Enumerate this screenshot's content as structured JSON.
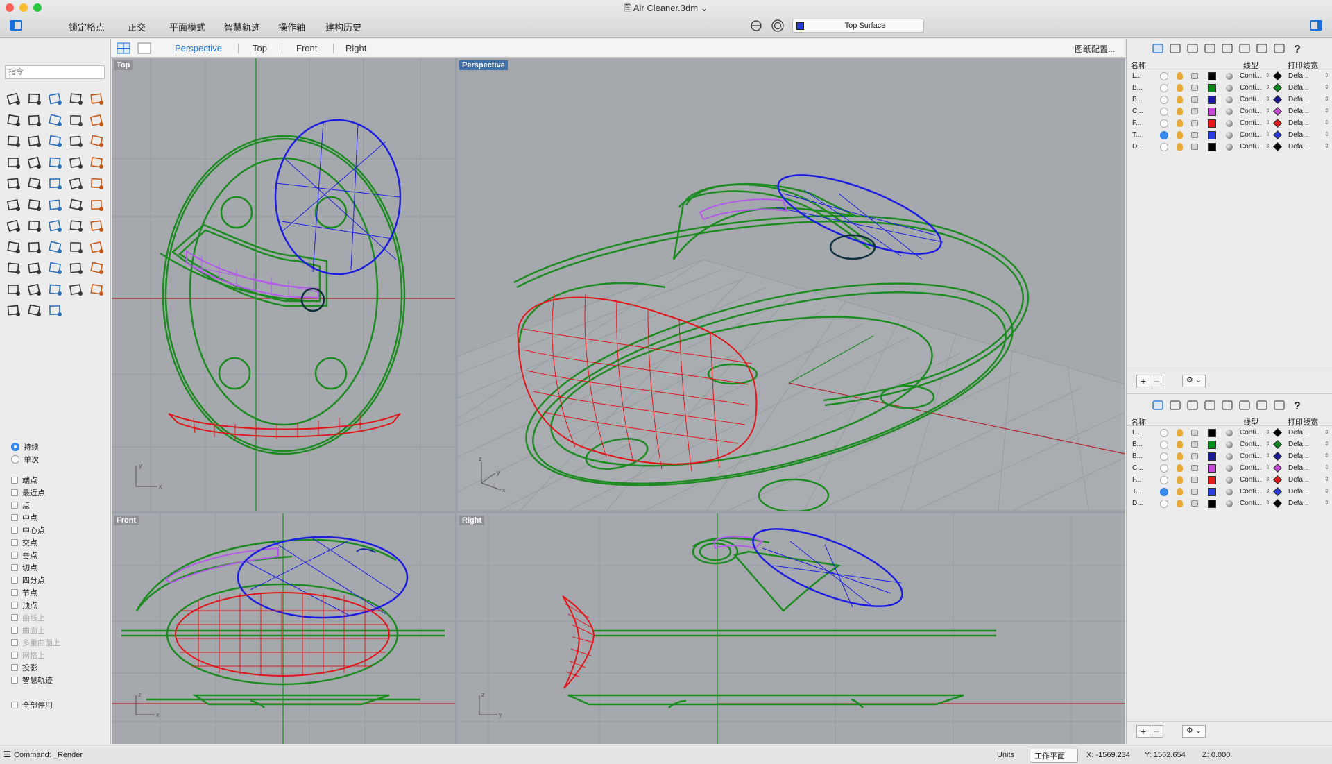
{
  "window": {
    "title": "Air Cleaner.3dm",
    "traffic_colors": [
      "#fc5f57",
      "#fdbc2e",
      "#28c840"
    ]
  },
  "toolbar": {
    "buttons": [
      "锁定格点",
      "正交",
      "平面模式",
      "智慧轨迹",
      "操作轴",
      "建构历史"
    ],
    "current_layer": "Top Surface",
    "current_layer_color": "#2a3de0"
  },
  "command": {
    "placeholder": "指令"
  },
  "view_tabs": {
    "tabs": [
      "Perspective",
      "Top",
      "Front",
      "Right"
    ],
    "active": "Perspective",
    "layout_button": "图纸配置..."
  },
  "viewports": {
    "top": "Top",
    "perspective": "Perspective",
    "front": "Front",
    "right": "Right"
  },
  "osnap": {
    "mode_options": [
      "持续",
      "单次"
    ],
    "mode_selected": "持续",
    "items": [
      {
        "label": "端点",
        "enabled": true
      },
      {
        "label": "最近点",
        "enabled": true
      },
      {
        "label": "点",
        "enabled": true
      },
      {
        "label": "中点",
        "enabled": true
      },
      {
        "label": "中心点",
        "enabled": true
      },
      {
        "label": "交点",
        "enabled": true
      },
      {
        "label": "垂点",
        "enabled": true
      },
      {
        "label": "切点",
        "enabled": true
      },
      {
        "label": "四分点",
        "enabled": true
      },
      {
        "label": "节点",
        "enabled": true
      },
      {
        "label": "顶点",
        "enabled": true
      },
      {
        "label": "曲线上",
        "enabled": false
      },
      {
        "label": "曲面上",
        "enabled": false
      },
      {
        "label": "多重曲面上",
        "enabled": false
      },
      {
        "label": "网格上",
        "enabled": false
      },
      {
        "label": "投影",
        "enabled": true
      },
      {
        "label": "智慧轨迹",
        "enabled": true
      }
    ],
    "disable_all": "全部停用"
  },
  "layers": {
    "headers": {
      "name": "名称",
      "linetype": "线型",
      "printwidth": "打印线宽"
    },
    "rows": [
      {
        "name": "L...",
        "color": "#000000",
        "linetype": "Conti...",
        "printwidth": "Defa...",
        "current": false
      },
      {
        "name": "B...",
        "color": "#0a8a1a",
        "linetype": "Conti...",
        "printwidth": "Defa...",
        "current": false
      },
      {
        "name": "B...",
        "color": "#1a1a9a",
        "linetype": "Conti...",
        "printwidth": "Defa...",
        "current": false
      },
      {
        "name": "C...",
        "color": "#c84ad8",
        "linetype": "Conti...",
        "printwidth": "Defa...",
        "current": false
      },
      {
        "name": "F...",
        "color": "#e51a1a",
        "linetype": "Conti...",
        "printwidth": "Defa...",
        "current": false
      },
      {
        "name": "T...",
        "color": "#2a3de0",
        "linetype": "Conti...",
        "printwidth": "Defa...",
        "current": true
      },
      {
        "name": "D...",
        "color": "#000000",
        "linetype": "Conti...",
        "printwidth": "Defa...",
        "current": false
      }
    ],
    "add": "+",
    "remove": "−",
    "gear": "⚙ ⌄"
  },
  "status": {
    "command": "Command: _Render",
    "units": "Units",
    "cplane": "工作平面",
    "x": "X: -1569.234",
    "y": "Y: 1562.654",
    "z": "Z: 0.000"
  },
  "colors": {
    "green": "#1e8a22",
    "blue": "#1d1de0",
    "red": "#e0161a",
    "purple": "#b35be8",
    "grid": "#979ca2",
    "axis_red": "#b4242a",
    "axis_green": "#1e8a22"
  }
}
